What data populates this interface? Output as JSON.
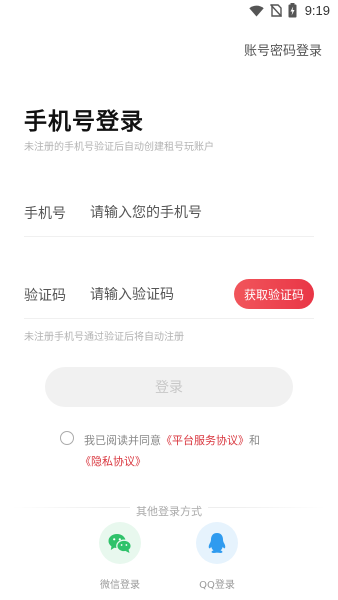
{
  "status_bar": {
    "time": "9:19",
    "icons": [
      "wifi-icon",
      "no-sim-icon",
      "battery-charging-icon"
    ]
  },
  "header": {
    "account_login_link": "账号密码登录"
  },
  "title": "手机号登录",
  "subtitle": "未注册的手机号验证后自动创建租号玩账户",
  "phone_field": {
    "label": "手机号",
    "placeholder": "请输入您的手机号",
    "value": ""
  },
  "code_field": {
    "label": "验证码",
    "placeholder": "请输入验证码",
    "value": "",
    "get_code_label": "获取验证码"
  },
  "hint": "未注册手机号通过验证后将自动注册",
  "login_button": "登录",
  "agreement": {
    "checked": false,
    "prefix": "我已阅读并同意",
    "platform_link": "《平台服务协议》",
    "and": "和",
    "privacy_link": "《隐私协议》"
  },
  "other_login": {
    "title": "其他登录方式",
    "wechat_label": "微信登录",
    "qq_label": "QQ登录"
  },
  "colors": {
    "accent": "#e93646",
    "link": "#d9363e",
    "wechat": "#2fc26a",
    "qq": "#2f9bef"
  }
}
